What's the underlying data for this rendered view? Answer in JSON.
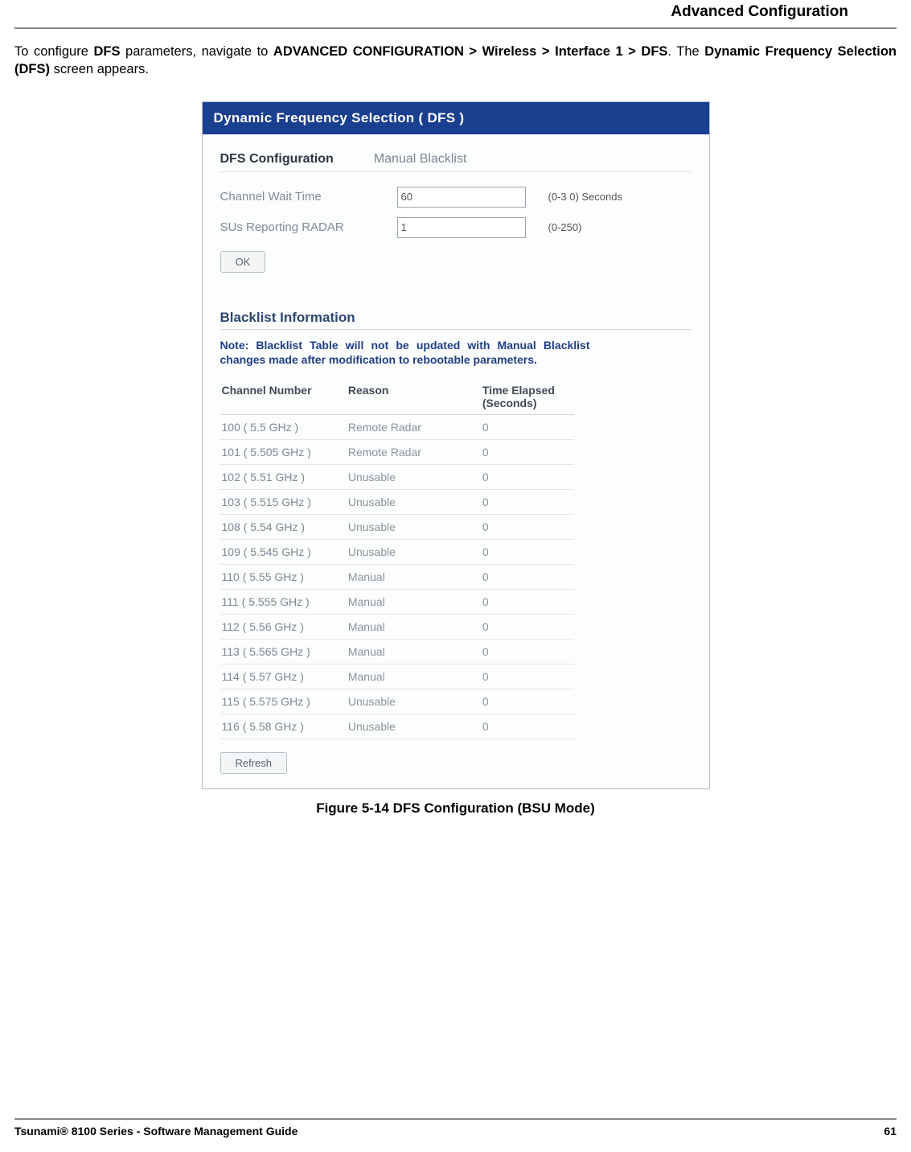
{
  "header": {
    "section": "Advanced Configuration"
  },
  "intro": {
    "p1a": "To configure ",
    "p1b": "DFS",
    "p1c": " parameters, navigate to ",
    "p1d": "ADVANCED CONFIGURATION > Wireless > Interface 1 > DFS",
    "p1e": ". The ",
    "p1f": "Dynamic Frequency Selection (DFS)",
    "p1g": " screen appears."
  },
  "window": {
    "title": "Dynamic Frequency Selection ( DFS )",
    "tabs": {
      "active": "DFS Configuration",
      "other": "Manual Blacklist"
    },
    "fields": {
      "channel_wait": {
        "label": "Channel Wait Time",
        "value": "60",
        "hint": "(0-3   0) Seconds"
      },
      "sus_reporting": {
        "label": "SUs Reporting RADAR",
        "value": "1",
        "hint": "(0-250)"
      }
    },
    "ok": "OK",
    "blacklist": {
      "heading": "Blacklist Information",
      "note": "Note: Blacklist  Table  will  not  be  updated  with  Manual  Blacklist changes made after modification to rebootable parameters.",
      "cols": {
        "c1": "Channel Number",
        "c2": "Reason",
        "c3": "Time Elapsed (Seconds)"
      },
      "rows": [
        {
          "ch": "100  ( 5.5 GHz )",
          "re": "Remote Radar",
          "ti": "0"
        },
        {
          "ch": "101  ( 5.505 GHz )",
          "re": "Remote Radar",
          "ti": "0"
        },
        {
          "ch": "102  ( 5.51 GHz )",
          "re": "Unusable",
          "ti": "0"
        },
        {
          "ch": "103  ( 5.515 GHz )",
          "re": "Unusable",
          "ti": "0"
        },
        {
          "ch": "108  ( 5.54 GHz )",
          "re": "Unusable",
          "ti": "0"
        },
        {
          "ch": "109  ( 5.545 GHz )",
          "re": "Unusable",
          "ti": "0"
        },
        {
          "ch": "110  ( 5.55 GHz )",
          "re": "Manual",
          "ti": "0"
        },
        {
          "ch": "111  ( 5.555 GHz )",
          "re": "Manual",
          "ti": "0"
        },
        {
          "ch": "112  ( 5.56 GHz )",
          "re": "Manual",
          "ti": "0"
        },
        {
          "ch": "113  ( 5.565 GHz )",
          "re": "Manual",
          "ti": "0"
        },
        {
          "ch": "114  ( 5.57 GHz )",
          "re": "Manual",
          "ti": "0"
        },
        {
          "ch": "115  ( 5.575 GHz )",
          "re": "Unusable",
          "ti": "0"
        },
        {
          "ch": "116  ( 5.58 GHz )",
          "re": "Unusable",
          "ti": "0"
        }
      ],
      "refresh": "Refresh"
    }
  },
  "caption": "Figure 5-14 DFS Configuration (BSU Mode)",
  "footer": {
    "left": "Tsunami® 8100 Series - Software Management Guide",
    "right": "61"
  }
}
